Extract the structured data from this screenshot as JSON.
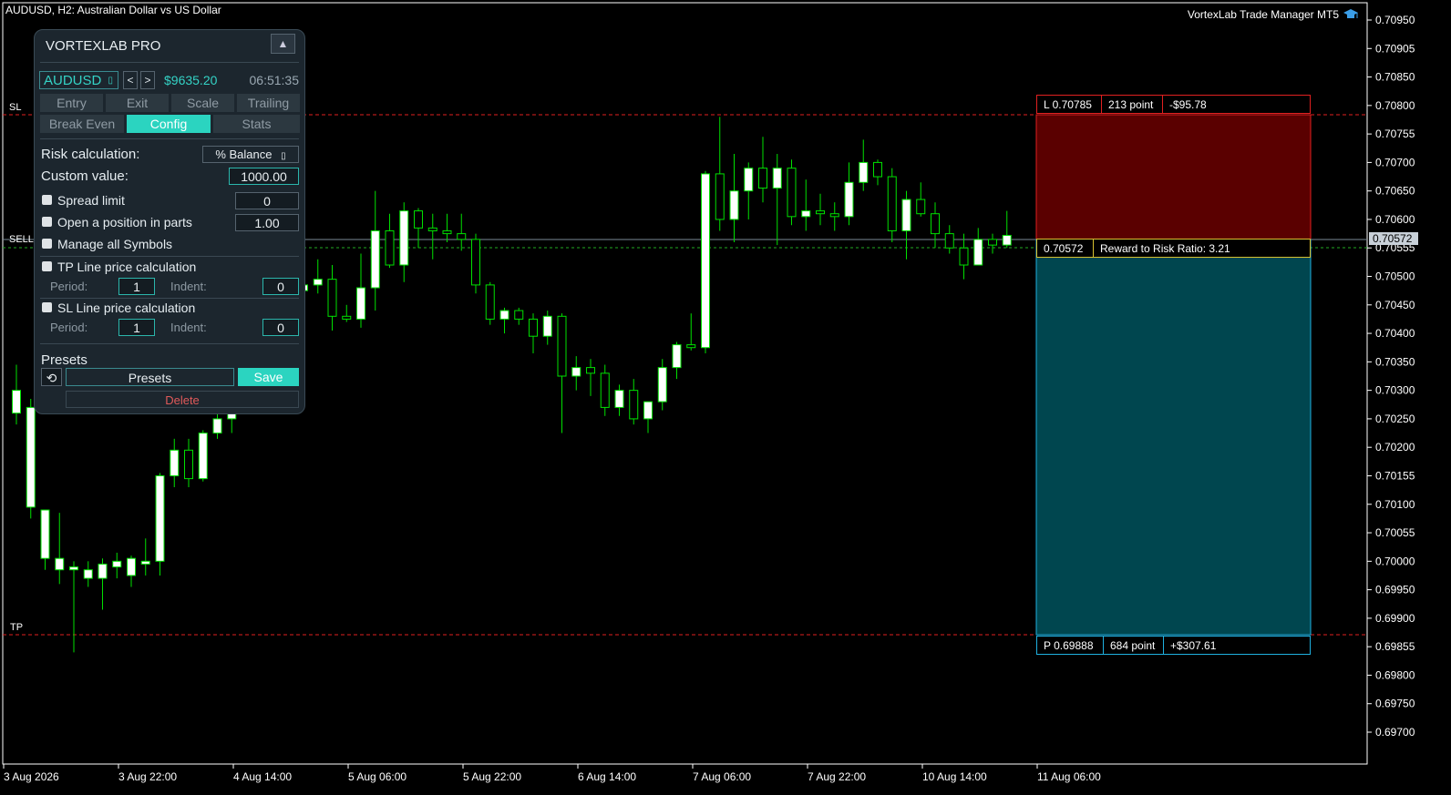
{
  "chart_header": {
    "title": "AUDUSD, H2:  Australian Dollar vs US Dollar",
    "brand": "VortexLab Trade Manager MT5",
    "brand_icon": "graduation-cap-icon"
  },
  "colors": {
    "bull_body": "#ffffff",
    "wick": "#00e000",
    "sl_line": "#e02020",
    "tp_line": "#3b82c4",
    "risk_zone": "#5a0000",
    "reward_zone": "#00464f",
    "accent": "#2bd4c0"
  },
  "price_axis": {
    "ticks": [
      "0.70950",
      "0.70905",
      "0.70850",
      "0.70800",
      "0.70755",
      "0.70700",
      "0.70650",
      "0.70600",
      "0.70555",
      "0.70500",
      "0.70450",
      "0.70400",
      "0.70350",
      "0.70300",
      "0.70250",
      "0.70200",
      "0.70155",
      "0.70100",
      "0.70055",
      "0.70000",
      "0.69950",
      "0.69900",
      "0.69855",
      "0.69800",
      "0.69750",
      "0.69700"
    ],
    "current_price": "0.70572"
  },
  "time_axis": {
    "ticks": [
      "3 Aug 2026",
      "3 Aug 22:00",
      "4 Aug 14:00",
      "5 Aug 06:00",
      "5 Aug 22:00",
      "6 Aug 14:00",
      "7 Aug 06:00",
      "7 Aug 22:00",
      "10 Aug 14:00",
      "11 Aug 06:00"
    ]
  },
  "lines": {
    "sl_label": "SL",
    "sell_label": "SELL",
    "tp_label": "TP"
  },
  "trade": {
    "sl_price": "L 0.70785",
    "sl_points": "213 point",
    "sl_money": "-$95.78",
    "entry_price": "0.70572",
    "rr_text": "Reward to Risk Ratio:  3.21",
    "tp_price": "P 0.69888",
    "tp_points": "684 point",
    "tp_money": "+$307.61"
  },
  "panel": {
    "title": "VORTEXLAB PRO",
    "collapse_label": "▲",
    "symbol": "AUDUSD",
    "prev_label": "<",
    "next_label": ">",
    "balance": "$9635.20",
    "clock": "06:51:35",
    "tabs": [
      "Entry",
      "Exit",
      "Scale",
      "Trailing",
      "Break Even",
      "Config",
      "Stats"
    ],
    "active_tab": "Config",
    "risk_label": "Risk calculation:",
    "risk_mode": "% Balance",
    "custom_label": "Custom value:",
    "custom_value": "1000.00",
    "spread_label": "Spread limit",
    "spread_value": "0",
    "parts_label": "Open a position in parts",
    "parts_value": "1.00",
    "manage_label": "Manage all Symbols",
    "tp_calc_label": "TP Line price calculation",
    "tp_period_label": "Period:",
    "tp_period": "1",
    "tp_indent_label": "Indent:",
    "tp_indent": "0",
    "sl_calc_label": "SL Line price calculation",
    "sl_period_label": "Period:",
    "sl_period": "1",
    "sl_indent_label": "Indent:",
    "sl_indent": "0",
    "presets_title": "Presets",
    "reset_label": "⟲",
    "presets_button": "Presets",
    "save_button": "Save",
    "delete_button": "Delete"
  },
  "chart_data": {
    "type": "candlestick",
    "price_range": [
      0.6967,
      0.70985
    ],
    "candles": [
      {
        "o": 0.7026,
        "h": 0.70345,
        "l": 0.7024,
        "c": 0.703
      },
      {
        "o": 0.70095,
        "h": 0.70285,
        "l": 0.70075,
        "c": 0.7027
      },
      {
        "o": 0.70005,
        "h": 0.70085,
        "l": 0.69985,
        "c": 0.7009
      },
      {
        "o": 0.69985,
        "h": 0.70085,
        "l": 0.6996,
        "c": 0.70005
      },
      {
        "o": 0.69985,
        "h": 0.7,
        "l": 0.6984,
        "c": 0.6999
      },
      {
        "o": 0.6997,
        "h": 0.7,
        "l": 0.69955,
        "c": 0.69985
      },
      {
        "o": 0.6997,
        "h": 0.70005,
        "l": 0.69915,
        "c": 0.69995
      },
      {
        "o": 0.6999,
        "h": 0.70015,
        "l": 0.6997,
        "c": 0.7
      },
      {
        "o": 0.69975,
        "h": 0.7001,
        "l": 0.69955,
        "c": 0.70005
      },
      {
        "o": 0.69995,
        "h": 0.7004,
        "l": 0.69975,
        "c": 0.7
      },
      {
        "o": 0.7,
        "h": 0.70155,
        "l": 0.69975,
        "c": 0.7015
      },
      {
        "o": 0.7015,
        "h": 0.70215,
        "l": 0.7013,
        "c": 0.70195
      },
      {
        "o": 0.70195,
        "h": 0.70215,
        "l": 0.7013,
        "c": 0.70145
      },
      {
        "o": 0.70145,
        "h": 0.7023,
        "l": 0.7014,
        "c": 0.70225
      },
      {
        "o": 0.70225,
        "h": 0.7029,
        "l": 0.70215,
        "c": 0.7025
      },
      {
        "o": 0.7025,
        "h": 0.7047,
        "l": 0.70225,
        "c": 0.70455
      },
      {
        "o": 0.70455,
        "h": 0.7052,
        "l": 0.7044,
        "c": 0.70505
      },
      {
        "o": 0.70505,
        "h": 0.7053,
        "l": 0.7047,
        "c": 0.7048
      },
      {
        "o": 0.7048,
        "h": 0.70515,
        "l": 0.7041,
        "c": 0.7044
      },
      {
        "o": 0.7044,
        "h": 0.7052,
        "l": 0.704,
        "c": 0.70475
      },
      {
        "o": 0.70475,
        "h": 0.7051,
        "l": 0.7046,
        "c": 0.70485
      },
      {
        "o": 0.70485,
        "h": 0.7053,
        "l": 0.7047,
        "c": 0.70495
      },
      {
        "o": 0.70495,
        "h": 0.7052,
        "l": 0.70405,
        "c": 0.7043
      },
      {
        "o": 0.7043,
        "h": 0.7045,
        "l": 0.7042,
        "c": 0.70425
      },
      {
        "o": 0.70425,
        "h": 0.7054,
        "l": 0.7041,
        "c": 0.7048
      },
      {
        "o": 0.7048,
        "h": 0.7065,
        "l": 0.7044,
        "c": 0.7058
      },
      {
        "o": 0.7058,
        "h": 0.7061,
        "l": 0.70515,
        "c": 0.7052
      },
      {
        "o": 0.7052,
        "h": 0.7063,
        "l": 0.7049,
        "c": 0.70615
      },
      {
        "o": 0.70615,
        "h": 0.7062,
        "l": 0.7055,
        "c": 0.70585
      },
      {
        "o": 0.70585,
        "h": 0.7061,
        "l": 0.7053,
        "c": 0.7058
      },
      {
        "o": 0.7058,
        "h": 0.7061,
        "l": 0.7056,
        "c": 0.70575
      },
      {
        "o": 0.70575,
        "h": 0.7061,
        "l": 0.70545,
        "c": 0.70565
      },
      {
        "o": 0.70565,
        "h": 0.70575,
        "l": 0.7047,
        "c": 0.70485
      },
      {
        "o": 0.70485,
        "h": 0.7049,
        "l": 0.70415,
        "c": 0.70425
      },
      {
        "o": 0.70425,
        "h": 0.70445,
        "l": 0.704,
        "c": 0.7044
      },
      {
        "o": 0.7044,
        "h": 0.70445,
        "l": 0.70415,
        "c": 0.70425
      },
      {
        "o": 0.70425,
        "h": 0.70435,
        "l": 0.70365,
        "c": 0.70395
      },
      {
        "o": 0.70395,
        "h": 0.7044,
        "l": 0.7038,
        "c": 0.7043
      },
      {
        "o": 0.7043,
        "h": 0.70435,
        "l": 0.70225,
        "c": 0.70325
      },
      {
        "o": 0.70325,
        "h": 0.7036,
        "l": 0.703,
        "c": 0.7034
      },
      {
        "o": 0.7034,
        "h": 0.70355,
        "l": 0.7029,
        "c": 0.7033
      },
      {
        "o": 0.7033,
        "h": 0.70345,
        "l": 0.70255,
        "c": 0.7027
      },
      {
        "o": 0.7027,
        "h": 0.7031,
        "l": 0.70255,
        "c": 0.703
      },
      {
        "o": 0.703,
        "h": 0.7032,
        "l": 0.7024,
        "c": 0.7025
      },
      {
        "o": 0.7025,
        "h": 0.7028,
        "l": 0.70225,
        "c": 0.7028
      },
      {
        "o": 0.7028,
        "h": 0.70355,
        "l": 0.70265,
        "c": 0.7034
      },
      {
        "o": 0.7034,
        "h": 0.70385,
        "l": 0.7032,
        "c": 0.7038
      },
      {
        "o": 0.7038,
        "h": 0.70435,
        "l": 0.7037,
        "c": 0.70375
      },
      {
        "o": 0.70375,
        "h": 0.70685,
        "l": 0.70365,
        "c": 0.7068
      },
      {
        "o": 0.7068,
        "h": 0.7078,
        "l": 0.7058,
        "c": 0.706
      },
      {
        "o": 0.706,
        "h": 0.70715,
        "l": 0.7056,
        "c": 0.7065
      },
      {
        "o": 0.7065,
        "h": 0.707,
        "l": 0.706,
        "c": 0.7069
      },
      {
        "o": 0.7069,
        "h": 0.70745,
        "l": 0.7063,
        "c": 0.70655
      },
      {
        "o": 0.70655,
        "h": 0.70715,
        "l": 0.70555,
        "c": 0.7069
      },
      {
        "o": 0.7069,
        "h": 0.70705,
        "l": 0.7059,
        "c": 0.70605
      },
      {
        "o": 0.70605,
        "h": 0.7067,
        "l": 0.7058,
        "c": 0.70615
      },
      {
        "o": 0.70615,
        "h": 0.70645,
        "l": 0.7059,
        "c": 0.7061
      },
      {
        "o": 0.7061,
        "h": 0.7063,
        "l": 0.7058,
        "c": 0.70605
      },
      {
        "o": 0.70605,
        "h": 0.707,
        "l": 0.7059,
        "c": 0.70665
      },
      {
        "o": 0.70665,
        "h": 0.7074,
        "l": 0.7065,
        "c": 0.707
      },
      {
        "o": 0.707,
        "h": 0.70705,
        "l": 0.7066,
        "c": 0.70675
      },
      {
        "o": 0.70675,
        "h": 0.7069,
        "l": 0.7056,
        "c": 0.7058
      },
      {
        "o": 0.7058,
        "h": 0.7065,
        "l": 0.7053,
        "c": 0.70635
      },
      {
        "o": 0.70635,
        "h": 0.70665,
        "l": 0.70605,
        "c": 0.7061
      },
      {
        "o": 0.7061,
        "h": 0.7063,
        "l": 0.7055,
        "c": 0.70575
      },
      {
        "o": 0.70575,
        "h": 0.7059,
        "l": 0.7054,
        "c": 0.7055
      },
      {
        "o": 0.7055,
        "h": 0.70575,
        "l": 0.70495,
        "c": 0.7052
      },
      {
        "o": 0.7052,
        "h": 0.70585,
        "l": 0.7052,
        "c": 0.70565
      },
      {
        "o": 0.70565,
        "h": 0.70575,
        "l": 0.7054,
        "c": 0.70555
      },
      {
        "o": 0.70555,
        "h": 0.70615,
        "l": 0.7055,
        "c": 0.70572
      }
    ]
  }
}
